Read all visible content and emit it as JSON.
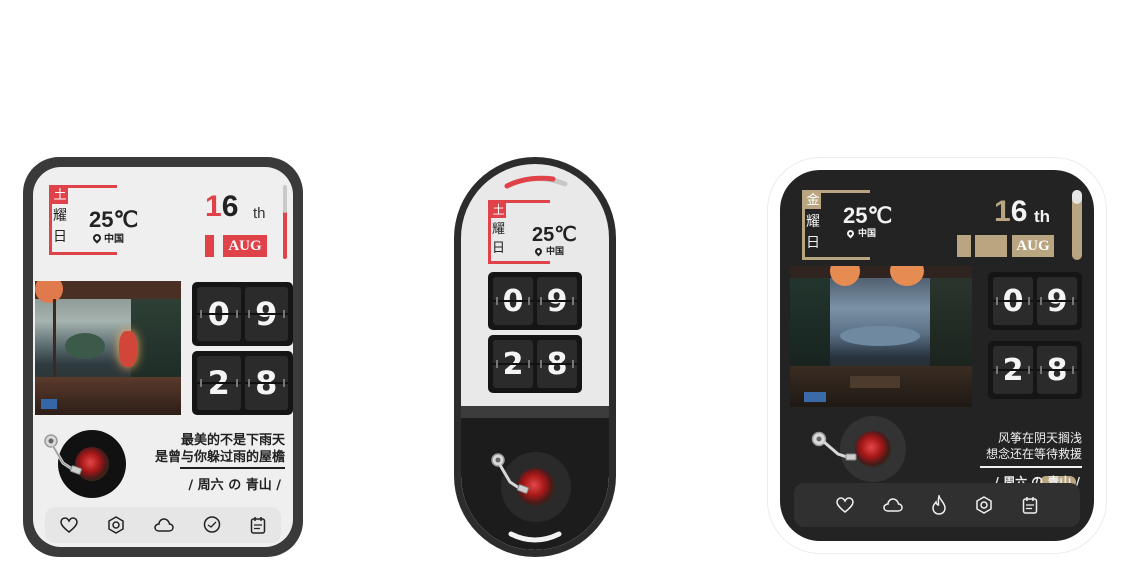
{
  "colors": {
    "red_accent": "#e0424a",
    "gold_accent": "#b9a57f",
    "watch_dark": "#232323",
    "screen_light": "#efefef"
  },
  "watch1": {
    "weekday_glyphs": [
      "土",
      "耀",
      "日"
    ],
    "temperature": "25℃",
    "location": "中国",
    "day": "1",
    "day_number2": "6",
    "day_suffix": "th",
    "month": "AUG",
    "hour_digits": [
      "0",
      "9"
    ],
    "minute_digits": [
      "2",
      "8"
    ],
    "quote_line1": "最美的不是下雨天",
    "quote_line2": "是曾与你躲过雨的屋檐",
    "signature": "/ 周六 の 青山 /",
    "icons": [
      "heart-icon",
      "settings-hex-icon",
      "cloud-icon",
      "chat-icon",
      "calendar-icon"
    ]
  },
  "watch2": {
    "weekday_glyphs": [
      "土",
      "耀",
      "日"
    ],
    "temperature": "25℃",
    "location": "中国",
    "hour_digits": [
      "0",
      "9"
    ],
    "minute_digits": [
      "2",
      "8"
    ]
  },
  "watch3": {
    "weekday_glyphs": [
      "金",
      "耀",
      "日"
    ],
    "temperature": "25℃",
    "location": "中国",
    "day": "1",
    "day_number2": "6",
    "day_suffix": "th",
    "month": "AUG",
    "hour_digits": [
      "0",
      "9"
    ],
    "minute_digits": [
      "2",
      "8"
    ],
    "quote_line1": "风筝在阴天搁浅",
    "quote_line2": "想念还在等待救援",
    "signature": "/ 周六 の 青山 /",
    "icons": [
      "heart-icon",
      "cloud-icon",
      "flame-icon",
      "settings-hex-icon",
      "calendar-icon"
    ]
  }
}
